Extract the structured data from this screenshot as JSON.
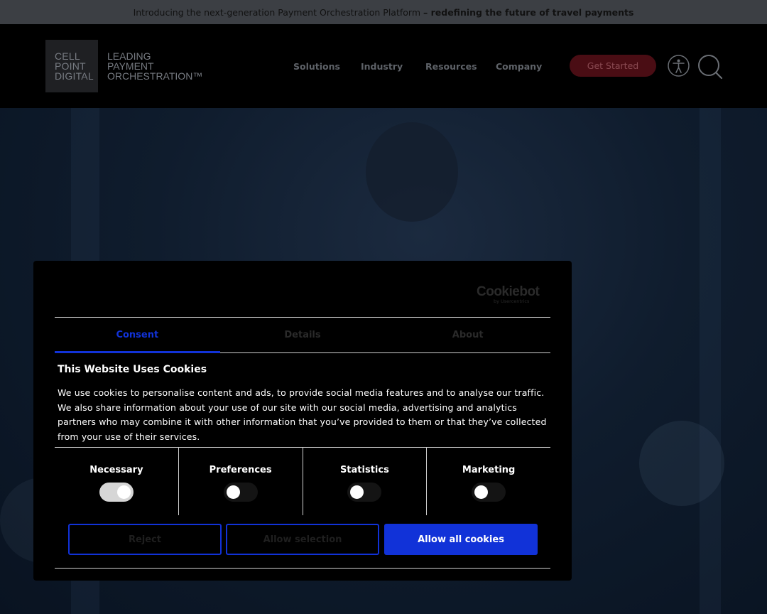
{
  "announcement": {
    "text": "Introducing the next-generation Payment Orchestration Platform",
    "emphasis": "– redefining the future of travel payments"
  },
  "logo": {
    "box_lines": [
      "CELL",
      "POINT",
      "DIGITAL"
    ],
    "text_lines": [
      "LEADING",
      "PAYMENT",
      "ORCHESTRATION™"
    ]
  },
  "nav": {
    "items": [
      "Solutions",
      "Industry",
      "Resources",
      "Company"
    ],
    "cta": "Get Started",
    "icons": [
      "accessibility-icon",
      "search-icon"
    ]
  },
  "cookie_dialog": {
    "brand": "Cookiebot",
    "brand_sub": "by Usercentrics",
    "tabs": [
      {
        "label": "Consent",
        "active": true
      },
      {
        "label": "Details",
        "active": false
      },
      {
        "label": "About",
        "active": false
      }
    ],
    "title": "This Website Uses Cookies",
    "body": "We use cookies to personalise content and ads, to provide social media features and to analyse our traffic. We also share information about your use of our site with our social media, advertising and analytics partners who may combine it with other information that you’ve provided to them or that they’ve collected from your use of their services.",
    "categories": [
      {
        "label": "Necessary",
        "checked": true
      },
      {
        "label": "Preferences",
        "checked": false
      },
      {
        "label": "Statistics",
        "checked": false
      },
      {
        "label": "Marketing",
        "checked": false
      }
    ],
    "buttons": {
      "reject": "Reject",
      "allow_selection": "Allow selection",
      "allow_all": "Allow all cookies"
    }
  },
  "colors": {
    "accent": "#1132d8",
    "cta_bg": "#4a0d14",
    "page_bg": "#0b1624"
  }
}
